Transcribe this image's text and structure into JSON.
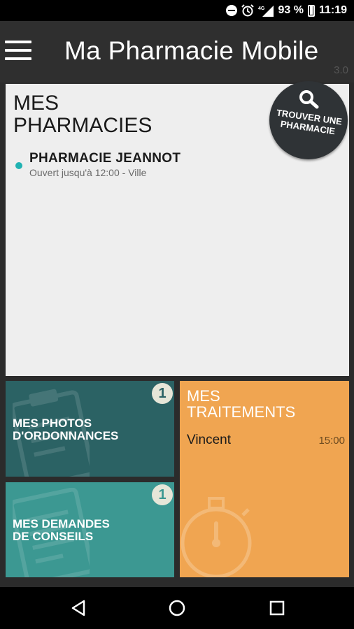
{
  "statusbar": {
    "network": "4G",
    "battery": "93 %",
    "time": "11:19"
  },
  "appbar": {
    "title": "Ma Pharmacie Mobile",
    "version": "3.0",
    "menu_icon": "hamburger-menu-icon"
  },
  "pharmacies": {
    "title": "MES\nPHARMACIES",
    "find_button": "TROUVER UNE\nPHARMACIE",
    "items": [
      {
        "name": "PHARMACIE JEANNOT",
        "status": "Ouvert jusqu'à 12:00 - Ville"
      }
    ]
  },
  "tiles": {
    "photos": {
      "label": "MES PHOTOS\nD'ORDONNANCES",
      "badge": "1"
    },
    "conseils": {
      "label": "MES DEMANDES\nDE CONSEILS",
      "badge": "1"
    },
    "traitements": {
      "title": "MES\nTRAITEMENTS",
      "entries": [
        {
          "name": "Vincent",
          "time": "15:00"
        }
      ]
    }
  },
  "colors": {
    "teal_dark": "#2b6264",
    "teal": "#3c9892",
    "orange": "#f0a551",
    "dot": "#20b2b2"
  },
  "navbar": {
    "icons": [
      "back-icon",
      "home-icon",
      "recents-icon"
    ]
  }
}
